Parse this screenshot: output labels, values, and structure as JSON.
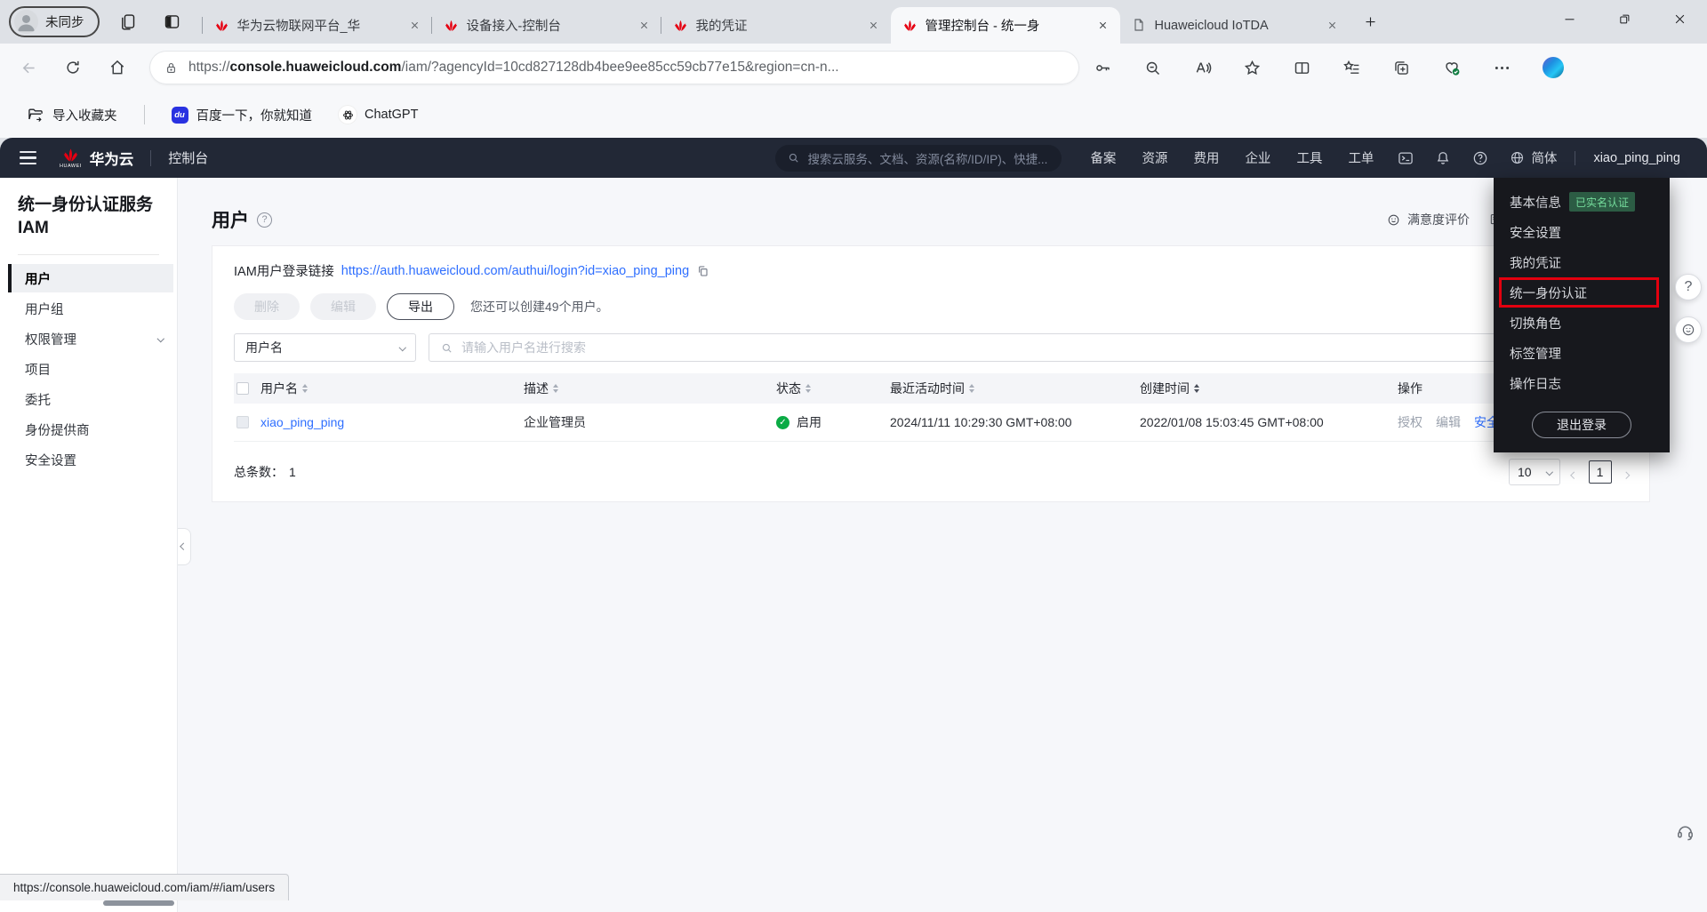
{
  "colors": {
    "huawei_red": "#E60012",
    "highlight_red": "#E3000F",
    "link_blue": "#2F6FFF",
    "status_green": "#0BAB45",
    "badge_green_bg": "#2C5C44",
    "badge_green_text": "#74DB9B",
    "header_dark": "#222836",
    "menu_dark": "#17181D"
  },
  "icons": {
    "baidu_glyph": "du",
    "help_glyph": "?",
    "check_glyph": "✓"
  },
  "browser": {
    "profile_label": "未同步",
    "tabs": [
      {
        "title": "华为云物联网平台_华",
        "icon": "huawei-logo"
      },
      {
        "title": "设备接入-控制台",
        "icon": "huawei-logo"
      },
      {
        "title": "我的凭证",
        "icon": "huawei-logo"
      },
      {
        "title": "管理控制台 - 统一身",
        "icon": "huawei-logo",
        "active": true
      },
      {
        "title": "Huaweicloud IoTDA",
        "icon": "document"
      }
    ],
    "url": {
      "scheme": "https://",
      "domain": "console.huaweicloud.com",
      "path": "/iam/?agencyId=10cd827128db4bee9ee85cc59cb77e15&region=cn-n..."
    },
    "bookmarks": [
      {
        "label": "导入收藏夹"
      },
      {
        "label": "百度一下，你就知道"
      },
      {
        "label": "ChatGPT"
      }
    ],
    "status_bar_url": "https://console.huaweicloud.com/iam/#/iam/users"
  },
  "console_header": {
    "logo_text": "HUAWEI",
    "brand": "华为云",
    "console_label": "控制台",
    "search_placeholder": "搜索云服务、文档、资源(名称/ID/IP)、快捷...",
    "nav_items": [
      "备案",
      "资源",
      "费用",
      "企业",
      "工具",
      "工单"
    ],
    "language": "简体",
    "username": "xiao_ping_ping"
  },
  "account_menu": {
    "items": [
      "基本信息",
      "安全设置",
      "我的凭证",
      "统一身份认证",
      "切换角色",
      "标签管理",
      "操作日志"
    ],
    "verified_badge": "已实名认证",
    "highlighted_item": "统一身份认证",
    "logout_label": "退出登录"
  },
  "sidebar": {
    "title_line1": "统一身份认证服务",
    "title_line2": "IAM",
    "items": [
      {
        "label": "用户",
        "active": true
      },
      {
        "label": "用户组"
      },
      {
        "label": "权限管理",
        "expandable": true
      },
      {
        "label": "项目"
      },
      {
        "label": "委托"
      },
      {
        "label": "身份提供商"
      },
      {
        "label": "安全设置"
      }
    ]
  },
  "main": {
    "page_title": "用户",
    "satisfaction_label": "满意度评价",
    "login_link_label": "IAM用户登录链接",
    "login_link_url": "https://auth.huaweicloud.com/authui/login?id=xiao_ping_ping",
    "delete_label": "删除",
    "edit_label": "编辑",
    "export_label": "导出",
    "quota_note": "您还可以创建49个用户。",
    "filter_field_label": "用户名",
    "search_placeholder": "请输入用户名进行搜索",
    "table": {
      "headers": [
        "用户名",
        "描述",
        "状态",
        "最近活动时间",
        "创建时间",
        "操作"
      ],
      "rows": [
        {
          "username": "xiao_ping_ping",
          "description": "企业管理员",
          "status": "启用",
          "last_activity": "2024/11/11 10:29:30 GMT+08:00",
          "created": "2022/01/08 15:03:45 GMT+08:00",
          "actions": [
            "授权",
            "编辑",
            "安全设置"
          ]
        }
      ]
    },
    "total_label": "总条数：",
    "total_count": "1",
    "page_size": "10",
    "current_page": "1"
  }
}
